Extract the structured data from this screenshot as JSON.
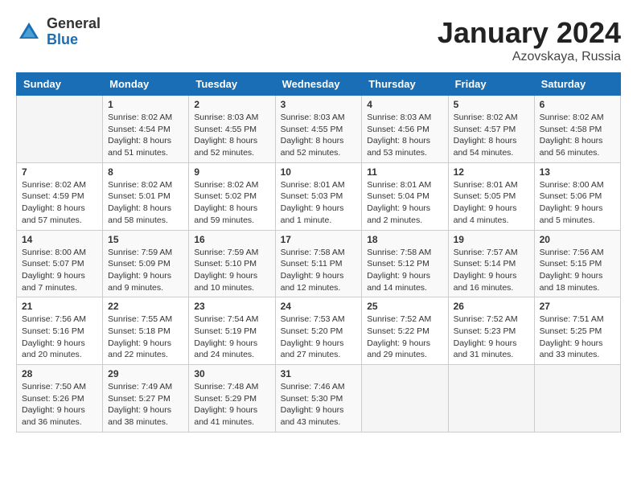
{
  "logo": {
    "general": "General",
    "blue": "Blue"
  },
  "header": {
    "title": "January 2024",
    "subtitle": "Azovskaya, Russia"
  },
  "weekdays": [
    "Sunday",
    "Monday",
    "Tuesday",
    "Wednesday",
    "Thursday",
    "Friday",
    "Saturday"
  ],
  "weeks": [
    [
      {
        "day": "",
        "info": ""
      },
      {
        "day": "1",
        "info": "Sunrise: 8:02 AM\nSunset: 4:54 PM\nDaylight: 8 hours\nand 51 minutes."
      },
      {
        "day": "2",
        "info": "Sunrise: 8:03 AM\nSunset: 4:55 PM\nDaylight: 8 hours\nand 52 minutes."
      },
      {
        "day": "3",
        "info": "Sunrise: 8:03 AM\nSunset: 4:55 PM\nDaylight: 8 hours\nand 52 minutes."
      },
      {
        "day": "4",
        "info": "Sunrise: 8:03 AM\nSunset: 4:56 PM\nDaylight: 8 hours\nand 53 minutes."
      },
      {
        "day": "5",
        "info": "Sunrise: 8:02 AM\nSunset: 4:57 PM\nDaylight: 8 hours\nand 54 minutes."
      },
      {
        "day": "6",
        "info": "Sunrise: 8:02 AM\nSunset: 4:58 PM\nDaylight: 8 hours\nand 56 minutes."
      }
    ],
    [
      {
        "day": "7",
        "info": "Sunrise: 8:02 AM\nSunset: 4:59 PM\nDaylight: 8 hours\nand 57 minutes."
      },
      {
        "day": "8",
        "info": "Sunrise: 8:02 AM\nSunset: 5:01 PM\nDaylight: 8 hours\nand 58 minutes."
      },
      {
        "day": "9",
        "info": "Sunrise: 8:02 AM\nSunset: 5:02 PM\nDaylight: 8 hours\nand 59 minutes."
      },
      {
        "day": "10",
        "info": "Sunrise: 8:01 AM\nSunset: 5:03 PM\nDaylight: 9 hours\nand 1 minute."
      },
      {
        "day": "11",
        "info": "Sunrise: 8:01 AM\nSunset: 5:04 PM\nDaylight: 9 hours\nand 2 minutes."
      },
      {
        "day": "12",
        "info": "Sunrise: 8:01 AM\nSunset: 5:05 PM\nDaylight: 9 hours\nand 4 minutes."
      },
      {
        "day": "13",
        "info": "Sunrise: 8:00 AM\nSunset: 5:06 PM\nDaylight: 9 hours\nand 5 minutes."
      }
    ],
    [
      {
        "day": "14",
        "info": "Sunrise: 8:00 AM\nSunset: 5:07 PM\nDaylight: 9 hours\nand 7 minutes."
      },
      {
        "day": "15",
        "info": "Sunrise: 7:59 AM\nSunset: 5:09 PM\nDaylight: 9 hours\nand 9 minutes."
      },
      {
        "day": "16",
        "info": "Sunrise: 7:59 AM\nSunset: 5:10 PM\nDaylight: 9 hours\nand 10 minutes."
      },
      {
        "day": "17",
        "info": "Sunrise: 7:58 AM\nSunset: 5:11 PM\nDaylight: 9 hours\nand 12 minutes."
      },
      {
        "day": "18",
        "info": "Sunrise: 7:58 AM\nSunset: 5:12 PM\nDaylight: 9 hours\nand 14 minutes."
      },
      {
        "day": "19",
        "info": "Sunrise: 7:57 AM\nSunset: 5:14 PM\nDaylight: 9 hours\nand 16 minutes."
      },
      {
        "day": "20",
        "info": "Sunrise: 7:56 AM\nSunset: 5:15 PM\nDaylight: 9 hours\nand 18 minutes."
      }
    ],
    [
      {
        "day": "21",
        "info": "Sunrise: 7:56 AM\nSunset: 5:16 PM\nDaylight: 9 hours\nand 20 minutes."
      },
      {
        "day": "22",
        "info": "Sunrise: 7:55 AM\nSunset: 5:18 PM\nDaylight: 9 hours\nand 22 minutes."
      },
      {
        "day": "23",
        "info": "Sunrise: 7:54 AM\nSunset: 5:19 PM\nDaylight: 9 hours\nand 24 minutes."
      },
      {
        "day": "24",
        "info": "Sunrise: 7:53 AM\nSunset: 5:20 PM\nDaylight: 9 hours\nand 27 minutes."
      },
      {
        "day": "25",
        "info": "Sunrise: 7:52 AM\nSunset: 5:22 PM\nDaylight: 9 hours\nand 29 minutes."
      },
      {
        "day": "26",
        "info": "Sunrise: 7:52 AM\nSunset: 5:23 PM\nDaylight: 9 hours\nand 31 minutes."
      },
      {
        "day": "27",
        "info": "Sunrise: 7:51 AM\nSunset: 5:25 PM\nDaylight: 9 hours\nand 33 minutes."
      }
    ],
    [
      {
        "day": "28",
        "info": "Sunrise: 7:50 AM\nSunset: 5:26 PM\nDaylight: 9 hours\nand 36 minutes."
      },
      {
        "day": "29",
        "info": "Sunrise: 7:49 AM\nSunset: 5:27 PM\nDaylight: 9 hours\nand 38 minutes."
      },
      {
        "day": "30",
        "info": "Sunrise: 7:48 AM\nSunset: 5:29 PM\nDaylight: 9 hours\nand 41 minutes."
      },
      {
        "day": "31",
        "info": "Sunrise: 7:46 AM\nSunset: 5:30 PM\nDaylight: 9 hours\nand 43 minutes."
      },
      {
        "day": "",
        "info": ""
      },
      {
        "day": "",
        "info": ""
      },
      {
        "day": "",
        "info": ""
      }
    ]
  ]
}
